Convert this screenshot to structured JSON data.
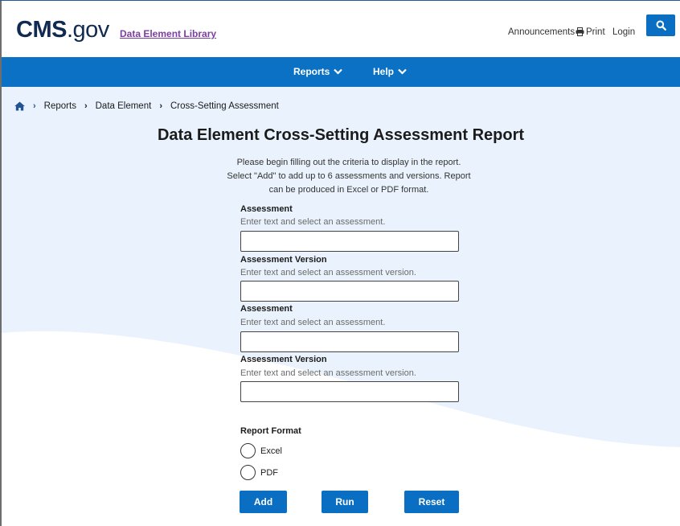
{
  "header": {
    "logo_main": "CMS",
    "logo_dot": ".",
    "logo_suffix": "gov",
    "app_link": "Data Element Library",
    "announcements": "Announcements",
    "print": "Print",
    "login": "Login",
    "search_icon": "magnifying-glass"
  },
  "nav": {
    "items": [
      {
        "label": "Reports"
      },
      {
        "label": "Help"
      }
    ]
  },
  "breadcrumb": {
    "items": [
      "Reports",
      "Data Element",
      "Cross-Setting Assessment"
    ]
  },
  "page": {
    "title": "Data Element Cross-Setting Assessment Report",
    "intro_lines": [
      "Please begin filling out the criteria to display in the report.",
      "Select \"Add\" to add up to 6 assessments and versions. Report",
      "can be produced in Excel or PDF format."
    ]
  },
  "form": {
    "fields": [
      {
        "label": "Assessment",
        "hint": "Enter text and select an assessment.",
        "value": ""
      },
      {
        "label": "Assessment Version",
        "hint": "Enter text and select an assessment version.",
        "value": ""
      },
      {
        "label": "Assessment",
        "hint": "Enter text and select an assessment.",
        "value": ""
      },
      {
        "label": "Assessment Version",
        "hint": "Enter text and select an assessment version.",
        "value": ""
      }
    ],
    "report_format_label": "Report Format",
    "formats": [
      {
        "label": "Excel",
        "checked": false
      },
      {
        "label": "PDF",
        "checked": false
      }
    ],
    "buttons": {
      "add": "Add",
      "run": "Run",
      "reset": "Reset"
    }
  },
  "colors": {
    "primary": "#0a71c4",
    "background": "#eaf3fd",
    "link_purple": "#7b3fa0",
    "logo_navy": "#102a52"
  }
}
